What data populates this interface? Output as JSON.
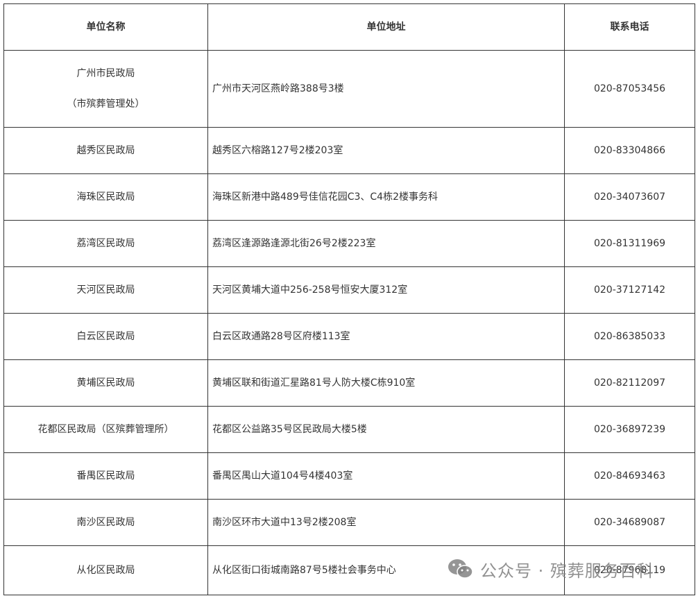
{
  "table": {
    "headers": [
      "单位名称",
      "单位地址",
      "联系电话"
    ],
    "rows": [
      {
        "name": "广州市民政局",
        "name_sub": "（市殡葬管理处）",
        "address": "广州市天河区燕岭路388号3楼",
        "phone": "020-87053456"
      },
      {
        "name": "越秀区民政局",
        "address": "越秀区六榕路127号2楼203室",
        "phone": "020-83304866"
      },
      {
        "name": "海珠区民政局",
        "address": "海珠区新港中路489号佳信花园C3、C4栋2楼事务科",
        "phone": "020-34073607"
      },
      {
        "name": "荔湾区民政局",
        "address": "荔湾区逢源路逢源北街26号2楼223室",
        "phone": "020-81311969"
      },
      {
        "name": "天河区民政局",
        "address": "天河区黄埔大道中256-258号恒安大厦312室",
        "phone": "020-37127142"
      },
      {
        "name": "白云区民政局",
        "address": "白云区政通路28号区府楼113室",
        "phone": "020-86385033"
      },
      {
        "name": "黄埔区民政局",
        "address": "黄埔区联和街道汇星路81号人防大楼C栋910室",
        "phone": "020-82112097"
      },
      {
        "name": "花都区民政局（区殡葬管理所）",
        "address": "花都区公益路35号区民政局大楼5楼",
        "phone": "020-36897239"
      },
      {
        "name": "番禺区民政局",
        "address": "番禺区禺山大道104号4楼403室",
        "phone": "020-84693463"
      },
      {
        "name": "南沙区民政局",
        "address": "南沙区环市大道中13号2楼208室",
        "phone": "020-34689087"
      },
      {
        "name": "从化区民政局",
        "address": "从化区街口街城南路87号5楼社会事务中心",
        "phone": "020-87968119"
      }
    ]
  },
  "watermark": {
    "text": "公众号 · 殡葬服务百科",
    "icon": "wechat-icon"
  }
}
